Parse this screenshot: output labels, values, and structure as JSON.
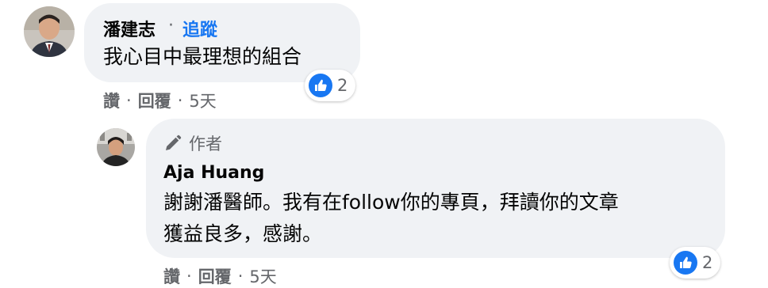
{
  "colors": {
    "bubble_bg": "#f0f2f5",
    "link_blue": "#1877f2",
    "secondary_text": "#65676b",
    "like_blue": "#1877f2"
  },
  "comments": [
    {
      "author": "潘建志",
      "separator": "·",
      "follow_label": "追蹤",
      "text": "我心目中最理想的組合",
      "reaction_icon": "like-icon",
      "reaction_count": "2",
      "actions": {
        "like": "讚",
        "dot1": "·",
        "reply": "回覆",
        "dot2": "·",
        "time": "5天"
      }
    },
    {
      "badge_icon": "pencil-icon",
      "badge_label": "作者",
      "author": "Aja Huang",
      "text_lines": [
        "謝謝潘醫師。我有在follow你的專頁，拜讀你的文章",
        "獲益良多，感謝。"
      ],
      "reaction_icon": "like-icon",
      "reaction_count": "2",
      "actions": {
        "like": "讚",
        "dot1": "·",
        "reply": "回覆",
        "dot2": "·",
        "time": "5天"
      }
    }
  ]
}
